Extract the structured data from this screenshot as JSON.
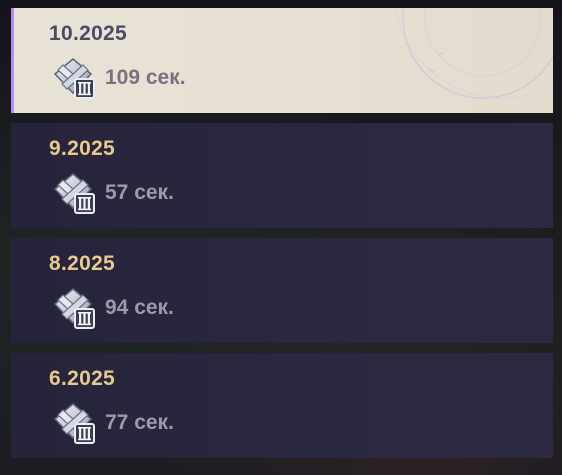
{
  "records": [
    {
      "period": "10.2025",
      "time": "109 сек.",
      "medal_icon": "medal-tier-iii-icon",
      "selected": true
    },
    {
      "period": "9.2025",
      "time": "57 сек.",
      "medal_icon": "medal-tier-iii-icon",
      "selected": false
    },
    {
      "period": "8.2025",
      "time": "94 сек.",
      "medal_icon": "medal-tier-iii-icon",
      "selected": false
    },
    {
      "period": "6.2025",
      "time": "77 сек.",
      "medal_icon": "medal-tier-iii-icon",
      "selected": false
    }
  ],
  "colors": {
    "selected_accent": "#b58cf0",
    "period_text": "#e7c98f",
    "time_text": "#9d9aa8"
  }
}
